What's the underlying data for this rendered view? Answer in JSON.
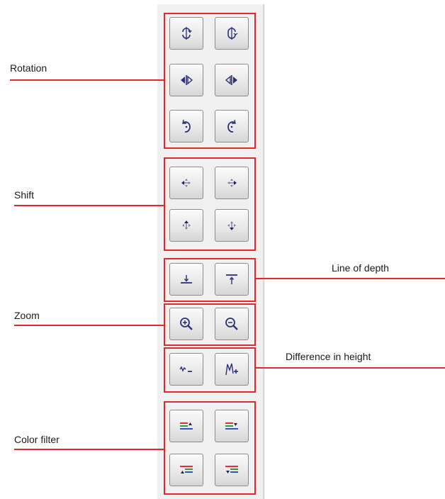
{
  "labels": {
    "rotation": "Rotation",
    "shift": "Shift",
    "line_of_depth": "Line  of  depth",
    "zoom": "Zoom",
    "difference_in_height": "Difference  in  height",
    "color_filter": "Color  filter"
  },
  "icons": {
    "rotation": [
      "rotate-vertical-cw-icon",
      "rotate-vertical-ccw-icon",
      "rotate-left-icon",
      "rotate-right-icon",
      "rotate-clockwise-icon",
      "rotate-counterclockwise-icon"
    ],
    "shift": [
      "shift-left-icon",
      "shift-right-icon",
      "shift-up-icon",
      "shift-down-icon"
    ],
    "line_of_depth": [
      "depth-line-down-icon",
      "depth-line-up-icon"
    ],
    "zoom": [
      "zoom-in-icon",
      "zoom-out-icon"
    ],
    "height": [
      "height-decrease-icon",
      "height-increase-icon"
    ],
    "color_filter": [
      "filter-up-icon",
      "filter-down-icon",
      "filter-upper-icon",
      "filter-lower-icon"
    ]
  },
  "colors": {
    "callout_red": "#e02a2a",
    "icon_navy": "#2b2f7a",
    "filter_red": "#e03030",
    "filter_green": "#2e9e3c",
    "filter_blue": "#3a4fc8"
  }
}
